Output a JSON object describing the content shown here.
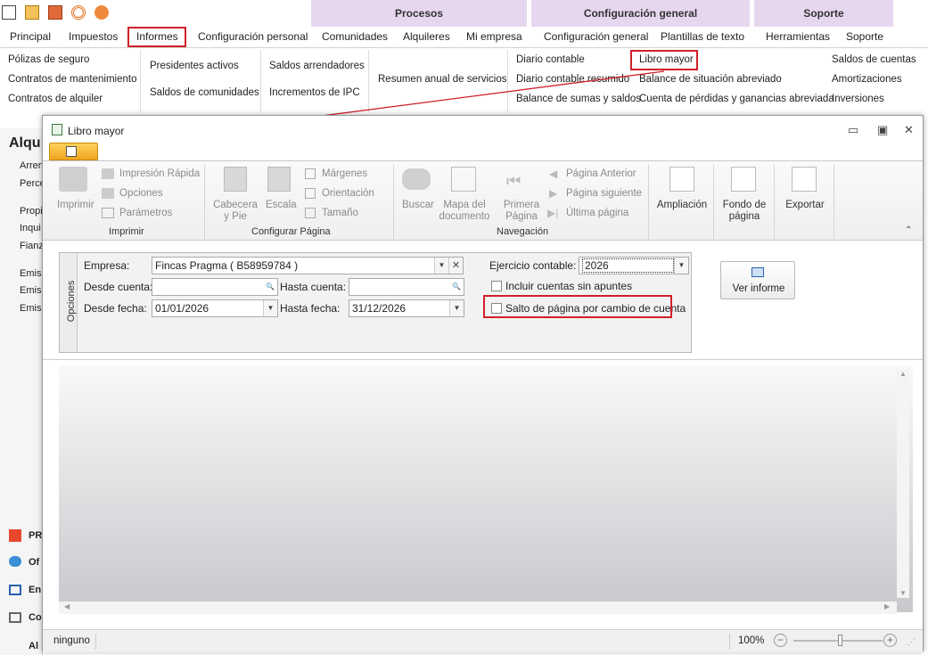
{
  "ribbon_groups": [
    {
      "label": "Procesos"
    },
    {
      "label": "Configuración general"
    },
    {
      "label": "Soporte"
    }
  ],
  "tabs": [
    "Principal",
    "Impuestos",
    "Informes",
    "Configuración personal",
    "Comunidades",
    "Alquileres",
    "Mi empresa",
    "Configuración general",
    "Plantillas de texto",
    "Herramientas",
    "Soporte"
  ],
  "reports": {
    "col1": [
      "Pólizas de seguro",
      "Contratos de mantenimiento",
      "Contratos de alquiler"
    ],
    "col2": [
      "Presidentes activos",
      "Saldos de comunidades"
    ],
    "col3": [
      "Saldos arrendadores",
      "Incrementos de IPC"
    ],
    "col4": [
      "Resumen anual de servicios"
    ],
    "col5": [
      "Diario contable",
      "Diario contable resumido",
      "Balance de sumas y saldos"
    ],
    "col6": [
      "Libro mayor",
      "Balance de situación abreviado",
      "Cuenta de pérdidas y ganancias abreviada"
    ],
    "col7": [
      "Saldos de cuentas",
      "Amortizaciones",
      "Inversiones"
    ]
  },
  "left_pane": {
    "title": "Alqu",
    "items": [
      "Arren",
      "Perce",
      "Propi",
      "Inqui",
      "Fianz",
      "Emisi",
      "Emisi",
      "Emisi"
    ],
    "bottom": [
      "PR",
      "Of",
      "En",
      "Co",
      "Al"
    ]
  },
  "window": {
    "title": "Libro mayor",
    "ribbon": {
      "imprimir": {
        "label": "Imprimir",
        "print": "Imprimir",
        "quick": "Impresión Rápida",
        "options": "Opciones",
        "params": "Parámetros"
      },
      "config": {
        "label": "Configurar Página",
        "header": "Cabecera y Pie",
        "scale": "Escala",
        "margins": "Márgenes",
        "orientation": "Orientación",
        "size": "Tamaño"
      },
      "nav": {
        "label": "Navegación",
        "search": "Buscar",
        "docmap": "Mapa del documento",
        "first": "Primera Página",
        "prev": "Página Anterior",
        "next": "Página siguiente",
        "last": "Última página"
      },
      "zoom": "Ampliación",
      "background": "Fondo de página",
      "export": "Exportar"
    },
    "options": {
      "side_label": "Opciones",
      "empresa_label": "Empresa:",
      "empresa_value": "Fincas Pragma ( B58959784 )",
      "desde_cuenta_label": "Desde cuenta:",
      "hasta_cuenta_label": "Hasta cuenta:",
      "desde_fecha_label": "Desde fecha:",
      "desde_fecha": "01/01/2026",
      "hasta_fecha_label": "Hasta fecha:",
      "hasta_fecha": "31/12/2026",
      "ejercicio_label": "Ejercicio contable:",
      "ejercicio": "2026",
      "check1": "Incluir cuentas sin apuntes",
      "check2": "Salto de página por cambio de cuenta",
      "ver_informe": "Ver informe"
    },
    "status": {
      "left": "ninguno",
      "zoom": "100%",
      "zoom_level_pct": 50
    }
  }
}
